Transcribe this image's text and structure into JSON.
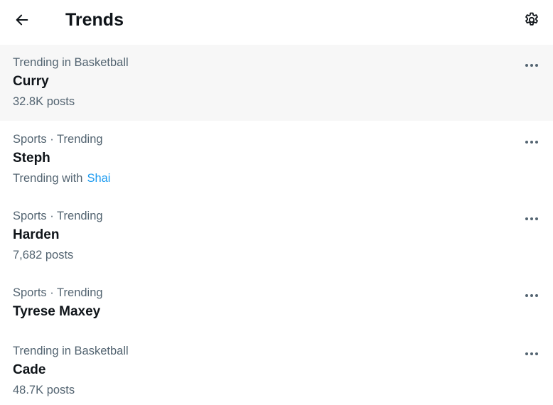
{
  "header": {
    "title": "Trends",
    "back_icon": "arrow-left-icon",
    "settings_icon": "gear-icon"
  },
  "trends": [
    {
      "meta": "Trending in Basketball",
      "name": "Curry",
      "sub": "32.8K posts"
    },
    {
      "meta": "Sports · Trending",
      "name": "Steph",
      "sub_prefix": "Trending with",
      "sub_link": "Shai"
    },
    {
      "meta": "Sports · Trending",
      "name": "Harden",
      "sub": "7,682 posts"
    },
    {
      "meta": "Sports · Trending",
      "name": "Tyrese Maxey"
    },
    {
      "meta": "Trending in Basketball",
      "name": "Cade",
      "sub": "48.7K posts"
    }
  ],
  "colors": {
    "text_primary": "#0f1419",
    "text_secondary": "#536471",
    "link": "#1d9bf0",
    "hover_bg": "#f7f7f7"
  },
  "more_icon": "more-horizontal-icon"
}
